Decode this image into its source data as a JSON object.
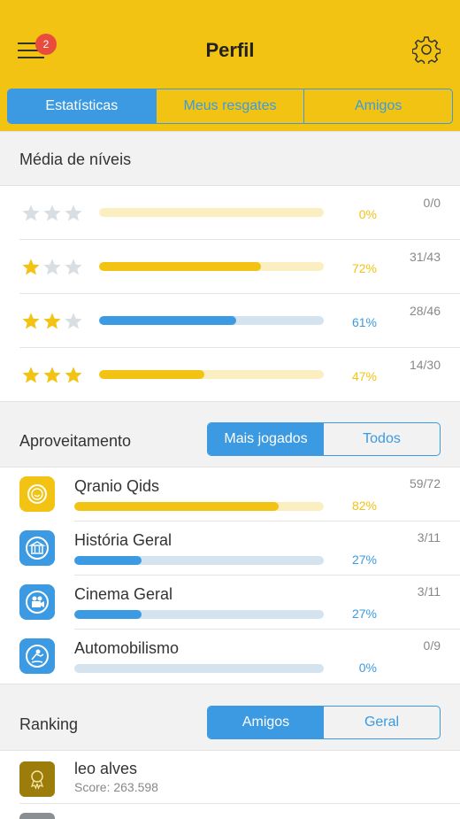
{
  "header": {
    "title": "Perfil",
    "notification_count": "2",
    "tabs": [
      {
        "label": "Estatísticas",
        "active": true
      },
      {
        "label": "Meus resgates",
        "active": false
      },
      {
        "label": "Amigos",
        "active": false
      }
    ]
  },
  "levels": {
    "title": "Média de níveis",
    "rows": [
      {
        "stars": 0,
        "percent": 0,
        "percent_label": "0%",
        "fraction": "0/0",
        "color": "#f2c313"
      },
      {
        "stars": 1,
        "percent": 72,
        "percent_label": "72%",
        "fraction": "31/43",
        "color": "#f2c313"
      },
      {
        "stars": 2,
        "percent": 61,
        "percent_label": "61%",
        "fraction": "28/46",
        "color": "#3b9ae1"
      },
      {
        "stars": 3,
        "percent": 47,
        "percent_label": "47%",
        "fraction": "14/30",
        "color": "#f2c313"
      }
    ]
  },
  "performance": {
    "title": "Aproveitamento",
    "toggle": [
      {
        "label": "Mais jogados",
        "active": true
      },
      {
        "label": "Todos",
        "active": false
      }
    ],
    "categories": [
      {
        "name": "Qranio Qids",
        "percent": 82,
        "percent_label": "82%",
        "fraction": "59/72",
        "icon": "qids-face-icon",
        "color": "#f2c313"
      },
      {
        "name": "História Geral",
        "percent": 27,
        "percent_label": "27%",
        "fraction": "3/11",
        "icon": "museum-icon",
        "color": "#3b9ae1"
      },
      {
        "name": "Cinema Geral",
        "percent": 27,
        "percent_label": "27%",
        "fraction": "3/11",
        "icon": "camera-icon",
        "color": "#3b9ae1"
      },
      {
        "name": "Automobilismo",
        "percent": 0,
        "percent_label": "0%",
        "fraction": "0/9",
        "icon": "racer-icon",
        "color": "#3b9ae1"
      }
    ]
  },
  "ranking": {
    "title": "Ranking",
    "toggle": [
      {
        "label": "Amigos",
        "active": true
      },
      {
        "label": "Geral",
        "active": false
      }
    ],
    "entries": [
      {
        "name": "leo alves",
        "score": "Score: 263.598",
        "icon": "medal-icon"
      },
      {
        "name": "",
        "score": "",
        "icon": "medal-icon"
      }
    ]
  },
  "colors": {
    "accent_yellow": "#f2c313",
    "accent_blue": "#3b9ae1",
    "track_yellow": "#fbefc2",
    "track_blue": "#d5e3ef",
    "star_empty": "#d9dee3",
    "rank_gold": "#9c7d0b"
  }
}
